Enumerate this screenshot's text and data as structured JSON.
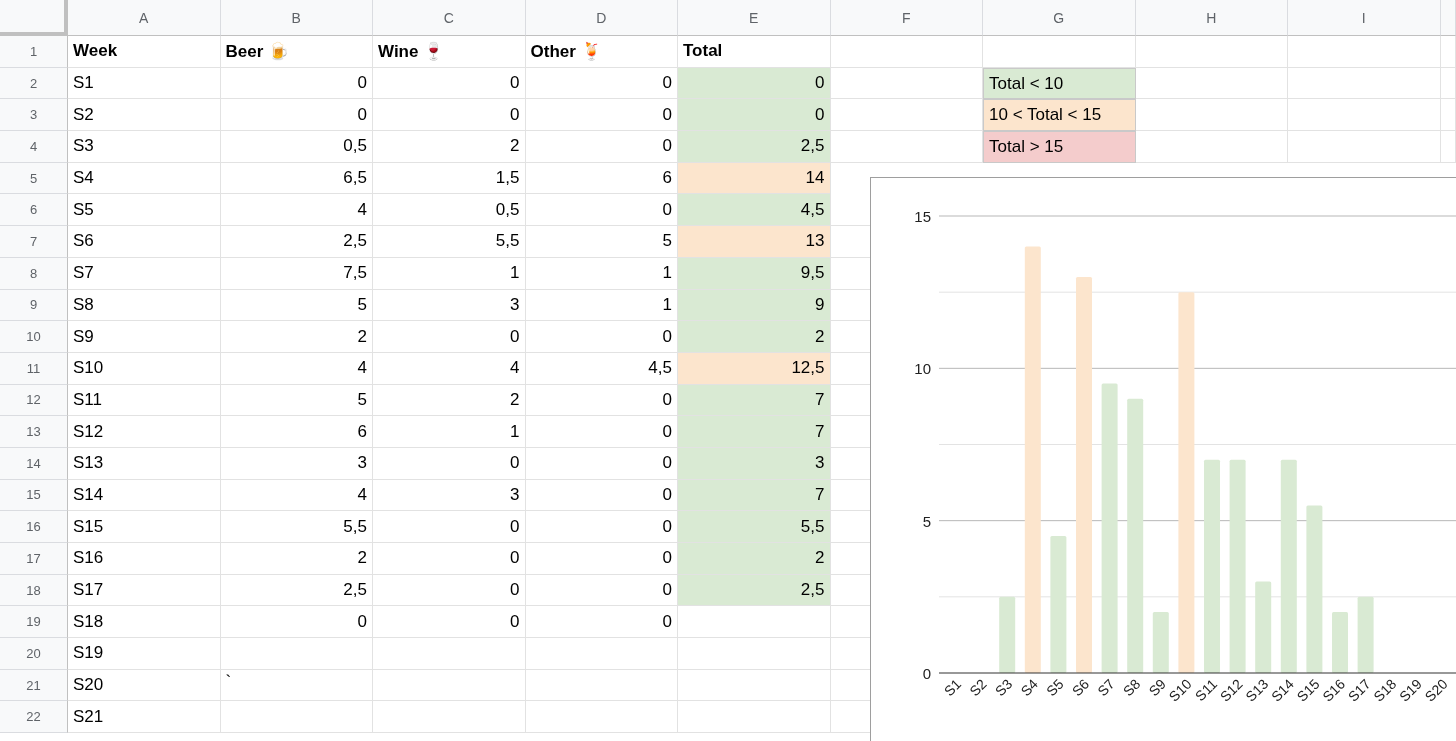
{
  "columns": [
    "A",
    "B",
    "C",
    "D",
    "E",
    "F",
    "G",
    "H",
    "I"
  ],
  "header_row": {
    "number": "1",
    "cells": [
      "Week",
      "Beer 🍺",
      "Wine 🍷",
      "Other 🍹",
      "Total"
    ]
  },
  "rows": [
    {
      "number": "2",
      "week": "S1",
      "numbers": [
        "0",
        "0",
        "0",
        "0"
      ],
      "color": "#d9ead3"
    },
    {
      "number": "3",
      "week": "S2",
      "numbers": [
        "0",
        "0",
        "0",
        "0"
      ],
      "color": "#d9ead3"
    },
    {
      "number": "4",
      "week": "S3",
      "numbers": [
        "0,5",
        "2",
        "0",
        "2,5"
      ],
      "color": "#d9ead3"
    },
    {
      "number": "5",
      "week": "S4",
      "numbers": [
        "6,5",
        "1,5",
        "6",
        "14"
      ],
      "color": "#fce5cd"
    },
    {
      "number": "6",
      "week": "S5",
      "numbers": [
        "4",
        "0,5",
        "0",
        "4,5"
      ],
      "color": "#d9ead3"
    },
    {
      "number": "7",
      "week": "S6",
      "numbers": [
        "2,5",
        "5,5",
        "5",
        "13"
      ],
      "color": "#fce5cd"
    },
    {
      "number": "8",
      "week": "S7",
      "numbers": [
        "7,5",
        "1",
        "1",
        "9,5"
      ],
      "color": "#d9ead3"
    },
    {
      "number": "9",
      "week": "S8",
      "numbers": [
        "5",
        "3",
        "1",
        "9"
      ],
      "color": "#d9ead3"
    },
    {
      "number": "10",
      "week": "S9",
      "numbers": [
        "2",
        "0",
        "0",
        "2"
      ],
      "color": "#d9ead3"
    },
    {
      "number": "11",
      "week": "S10",
      "numbers": [
        "4",
        "4",
        "4,5",
        "12,5"
      ],
      "color": "#fce5cd"
    },
    {
      "number": "12",
      "week": "S11",
      "numbers": [
        "5",
        "2",
        "0",
        "7"
      ],
      "color": "#d9ead3"
    },
    {
      "number": "13",
      "week": "S12",
      "numbers": [
        "6",
        "1",
        "0",
        "7"
      ],
      "color": "#d9ead3"
    },
    {
      "number": "14",
      "week": "S13",
      "numbers": [
        "3",
        "0",
        "0",
        "3"
      ],
      "color": "#d9ead3"
    },
    {
      "number": "15",
      "week": "S14",
      "numbers": [
        "4",
        "3",
        "0",
        "7"
      ],
      "color": "#d9ead3"
    },
    {
      "number": "16",
      "week": "S15",
      "numbers": [
        "5,5",
        "0",
        "0",
        "5,5"
      ],
      "color": "#d9ead3"
    },
    {
      "number": "17",
      "week": "S16",
      "numbers": [
        "2",
        "0",
        "0",
        "2"
      ],
      "color": "#d9ead3"
    },
    {
      "number": "18",
      "week": "S17",
      "numbers": [
        "2,5",
        "0",
        "0",
        "2,5"
      ],
      "color": "#d9ead3"
    },
    {
      "number": "19",
      "week": "S18",
      "numbers": [
        "0",
        "0",
        "0"
      ]
    },
    {
      "number": "20",
      "week": "S19"
    },
    {
      "number": "21",
      "week": "S20",
      "note": "`"
    },
    {
      "number": "22",
      "week": "S21"
    }
  ],
  "legend": [
    {
      "label": "Total < 10",
      "color": "#d9ead3"
    },
    {
      "label": "10 < Total < 15",
      "color": "#fce5cd"
    },
    {
      "label": "Total > 15",
      "color": "#f4cccc"
    }
  ],
  "chart": {
    "chart_data": {
      "type": "bar",
      "categories": [
        "S1",
        "S2",
        "S3",
        "S4",
        "S5",
        "S6",
        "S7",
        "S8",
        "S9",
        "S10",
        "S11",
        "S12",
        "S13",
        "S14",
        "S15",
        "S16",
        "S17",
        "S18",
        "S19",
        "S20"
      ],
      "series": [
        {
          "values": [
            0,
            0,
            2.5,
            14,
            4.5,
            13,
            9.5,
            9,
            2,
            12.5,
            7,
            7,
            3,
            7,
            5.5,
            2,
            2.5,
            null,
            null,
            null
          ]
        }
      ],
      "ylim": [
        0,
        15
      ],
      "yticks": [
        0,
        5,
        10,
        15
      ]
    }
  }
}
